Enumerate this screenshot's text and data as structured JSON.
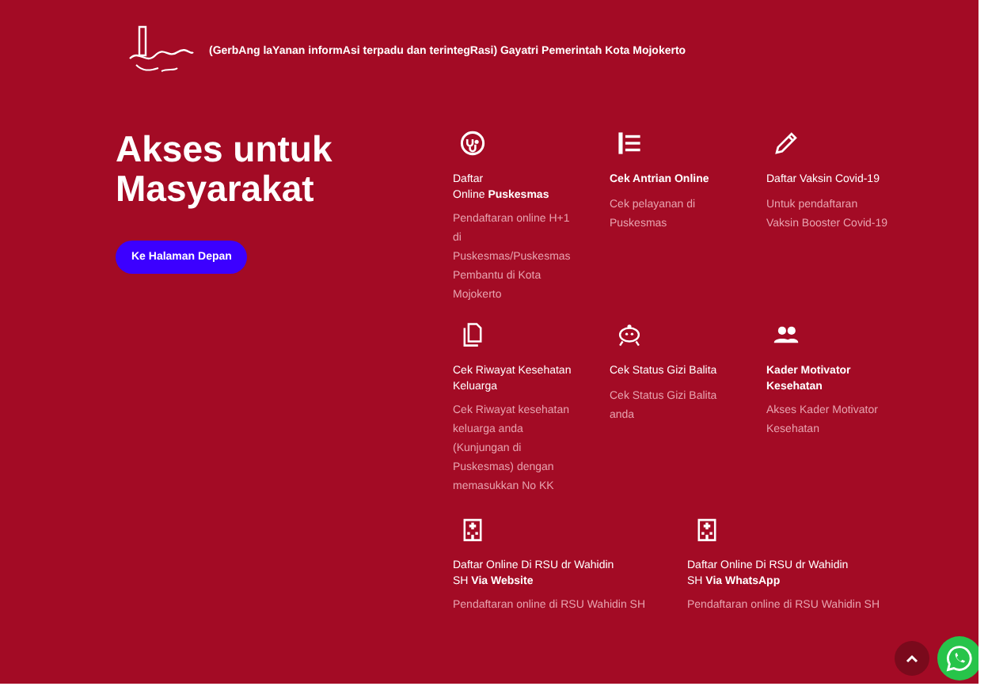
{
  "header": {
    "tagline": "(GerbAng laYanan informAsi terpadu dan terintegRasi) Gayatri Pemerintah Kota Mojokerto"
  },
  "hero": {
    "title": "Akses untuk Masyarakat",
    "button": "Ke Halaman Depan"
  },
  "services": [
    {
      "kind": "stethoscope",
      "title_lines": [
        "Daftar",
        "Online **Puskesmas**"
      ],
      "emphasis": false,
      "description": "Pendaftaran online H+1 di Puskesmas/Puskesmas Pembantu di Kota Mojokerto"
    },
    {
      "kind": "list",
      "title_lines": [
        "Cek Antrian Online"
      ],
      "emphasis": true,
      "description": "Cek pelayanan di Puskesmas"
    },
    {
      "kind": "pencil",
      "title_lines": [
        "Daftar Vaksin Covid-19"
      ],
      "emphasis": false,
      "description": "Untuk pendaftaran Vaksin Booster Covid-19"
    },
    {
      "kind": "document",
      "title_lines": [
        "Cek Riwayat Kesehatan",
        "Keluarga"
      ],
      "emphasis": false,
      "description": "Cek Riwayat kesehatan keluarga anda (Kunjungan di Puskesmas) dengan memasukkan No KK"
    },
    {
      "kind": "baby",
      "title_lines": [
        "Cek Status Gizi Balita"
      ],
      "emphasis": false,
      "description": "Cek Status Gizi Balita anda"
    },
    {
      "kind": "people",
      "title_lines": [
        "Kader Motivator",
        "Kesehatan"
      ],
      "emphasis": true,
      "description": "Akses Kader Motivator Kesehatan"
    }
  ],
  "hospital_services": [
    {
      "kind": "hospital",
      "title_lines": [
        "Daftar Online Di RSU dr Wahidin",
        "SH **Via Website**"
      ],
      "emphasis": false,
      "description": "Pendaftaran online di RSU Wahidin SH"
    },
    {
      "kind": "hospital",
      "title_lines": [
        "Daftar Online Di RSU dr Wahidin",
        "SH **Via WhatsApp**"
      ],
      "emphasis": false,
      "description": "Pendaftaran online di RSU Wahidin SH"
    }
  ]
}
